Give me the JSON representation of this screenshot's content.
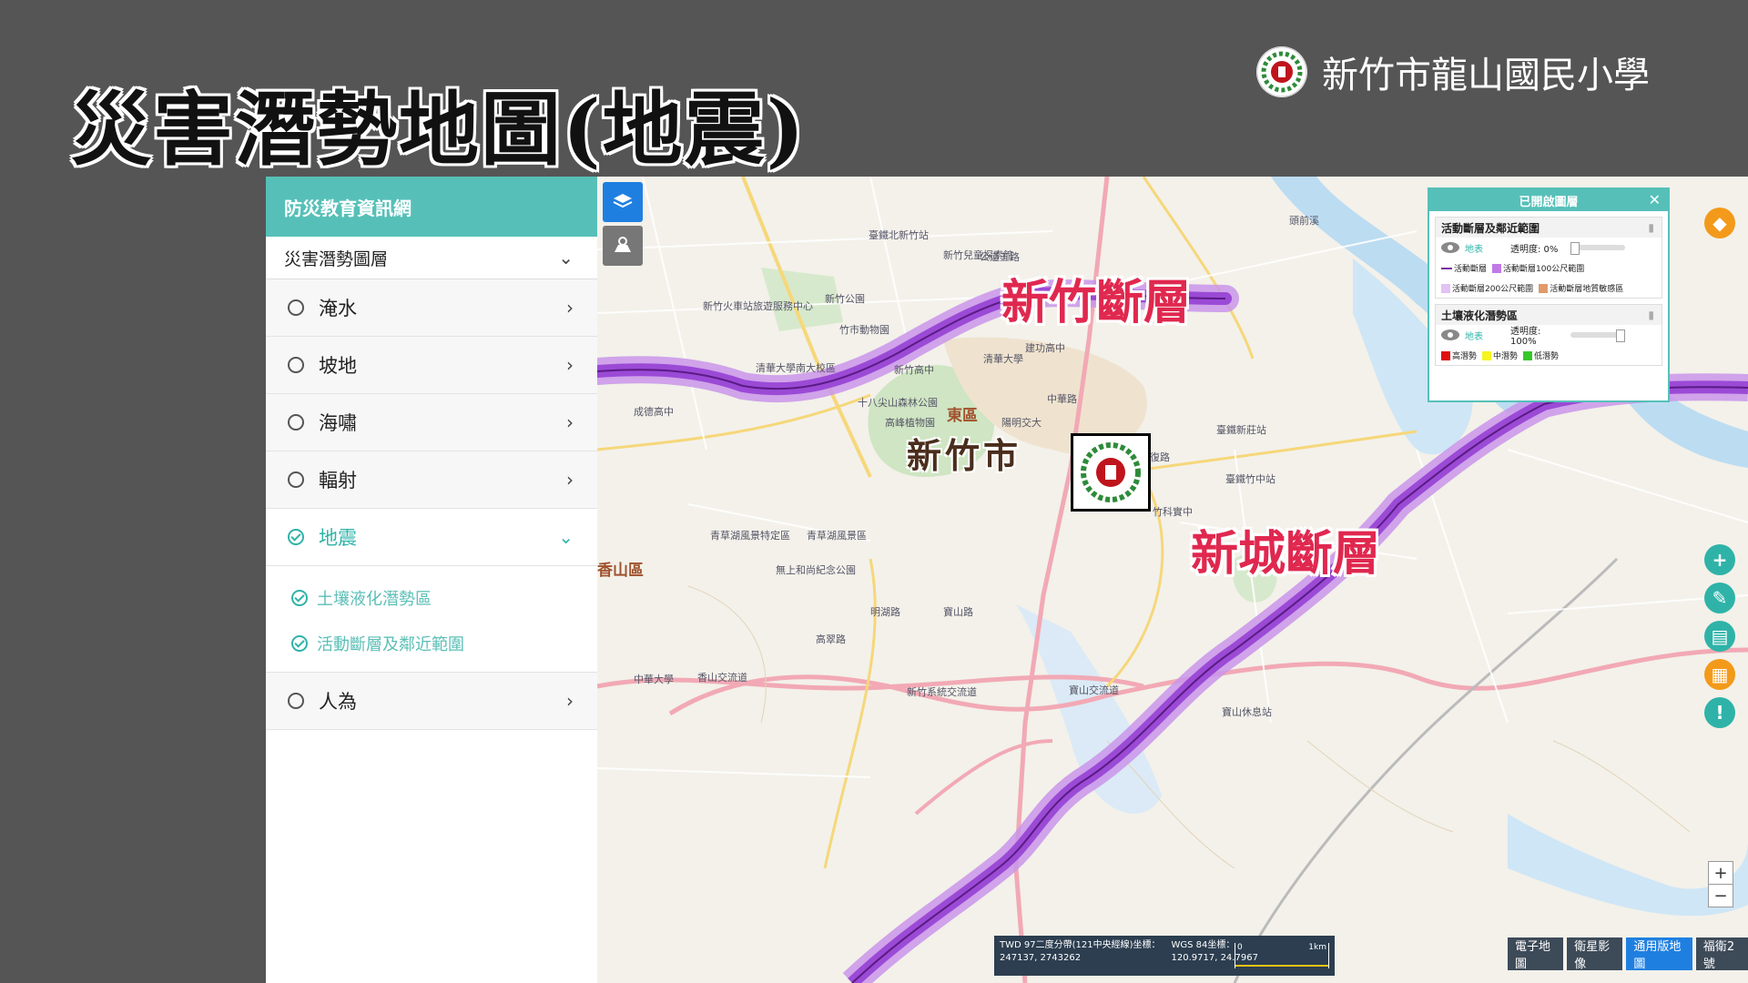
{
  "slide": {
    "title": "災害潛勢地圖(地震)",
    "school_name": "新竹市龍山國民小學"
  },
  "sidebar": {
    "header": "防災教育資訊網",
    "section": "災害潛勢圖層",
    "categories": [
      {
        "label": "淹水",
        "active": false
      },
      {
        "label": "坡地",
        "active": false
      },
      {
        "label": "海嘯",
        "active": false
      },
      {
        "label": "輻射",
        "active": false
      },
      {
        "label": "地震",
        "active": true
      },
      {
        "label": "人為",
        "active": false
      }
    ],
    "earthquake_subitems": [
      "土壤液化潛勢區",
      "活動斷層及鄰近範圍"
    ]
  },
  "map": {
    "faults": [
      "新竹斷層",
      "新城斷層"
    ],
    "city": "新竹市",
    "district": "東區",
    "district_west": "香山區",
    "labels": [
      "清華大學",
      "陽明交大",
      "竹科實中",
      "新竹高中",
      "建功高中",
      "成德高中",
      "十八尖山森林公園",
      "高峰植物園",
      "新竹公園",
      "竹市動物園",
      "新竹火車站旅遊服務中心",
      "中華大學",
      "青草湖風景特定區",
      "青草湖風景區",
      "無上和尚紀念公園",
      "香山交流道",
      "新竹系統交流道",
      "寶山休息站",
      "臺鐵竹中站",
      "臺鐵新莊站",
      "寶山交流道",
      "中華路",
      "光復路",
      "公道五路",
      "清華大學南大校區",
      "新竹兒童探索館",
      "臺鐵北新竹站",
      "頭前溪",
      "寶山路",
      "明湖路",
      "高翠路"
    ]
  },
  "layer_panel": {
    "title": "已開啟圖層",
    "fault_section": "活動斷層及鄰近範圍",
    "fault_opacity": "透明度: 0%",
    "fault_legend": [
      "活動斷層",
      "活動斷層100公尺範圍",
      "活動斷層200公尺範圍",
      "活動斷層地質敏感區"
    ],
    "liq_section": "土壤液化潛勢區",
    "liq_opacity": "透明度: 100%",
    "liq_legend": [
      "高潛勢",
      "中潛勢",
      "低潛勢"
    ],
    "layer_toggle": "地表",
    "colors": {
      "fault_line": "#7b2fa0",
      "fault_100m": "#c07ae8",
      "fault_200m": "#e3c2f5",
      "fault_geo": "#e09a6a",
      "high": "#e01010",
      "mid": "#f5f520",
      "low": "#36c82a"
    }
  },
  "coords": {
    "twd_label": "TWD 97二度分帶(121中央經線)坐標：",
    "twd_value": "247137, 2743262",
    "wgs_label": "WGS 84坐標：",
    "wgs_value": "120.9717, 24.7967",
    "scale_start": "0",
    "scale_end": "1km"
  },
  "basemaps": [
    "電子地圖",
    "衛星影像",
    "通用版地圖",
    "福衛2號"
  ],
  "active_basemap": "通用版地圖",
  "icons": {
    "layers": "layers-icon",
    "locate": "locate-icon",
    "compass": "compass-icon",
    "add": "plus-circle-icon",
    "draw": "pen-icon",
    "print": "print-icon",
    "book": "book-icon",
    "info": "alert-icon"
  },
  "zoom": {
    "in": "+",
    "out": "−"
  }
}
